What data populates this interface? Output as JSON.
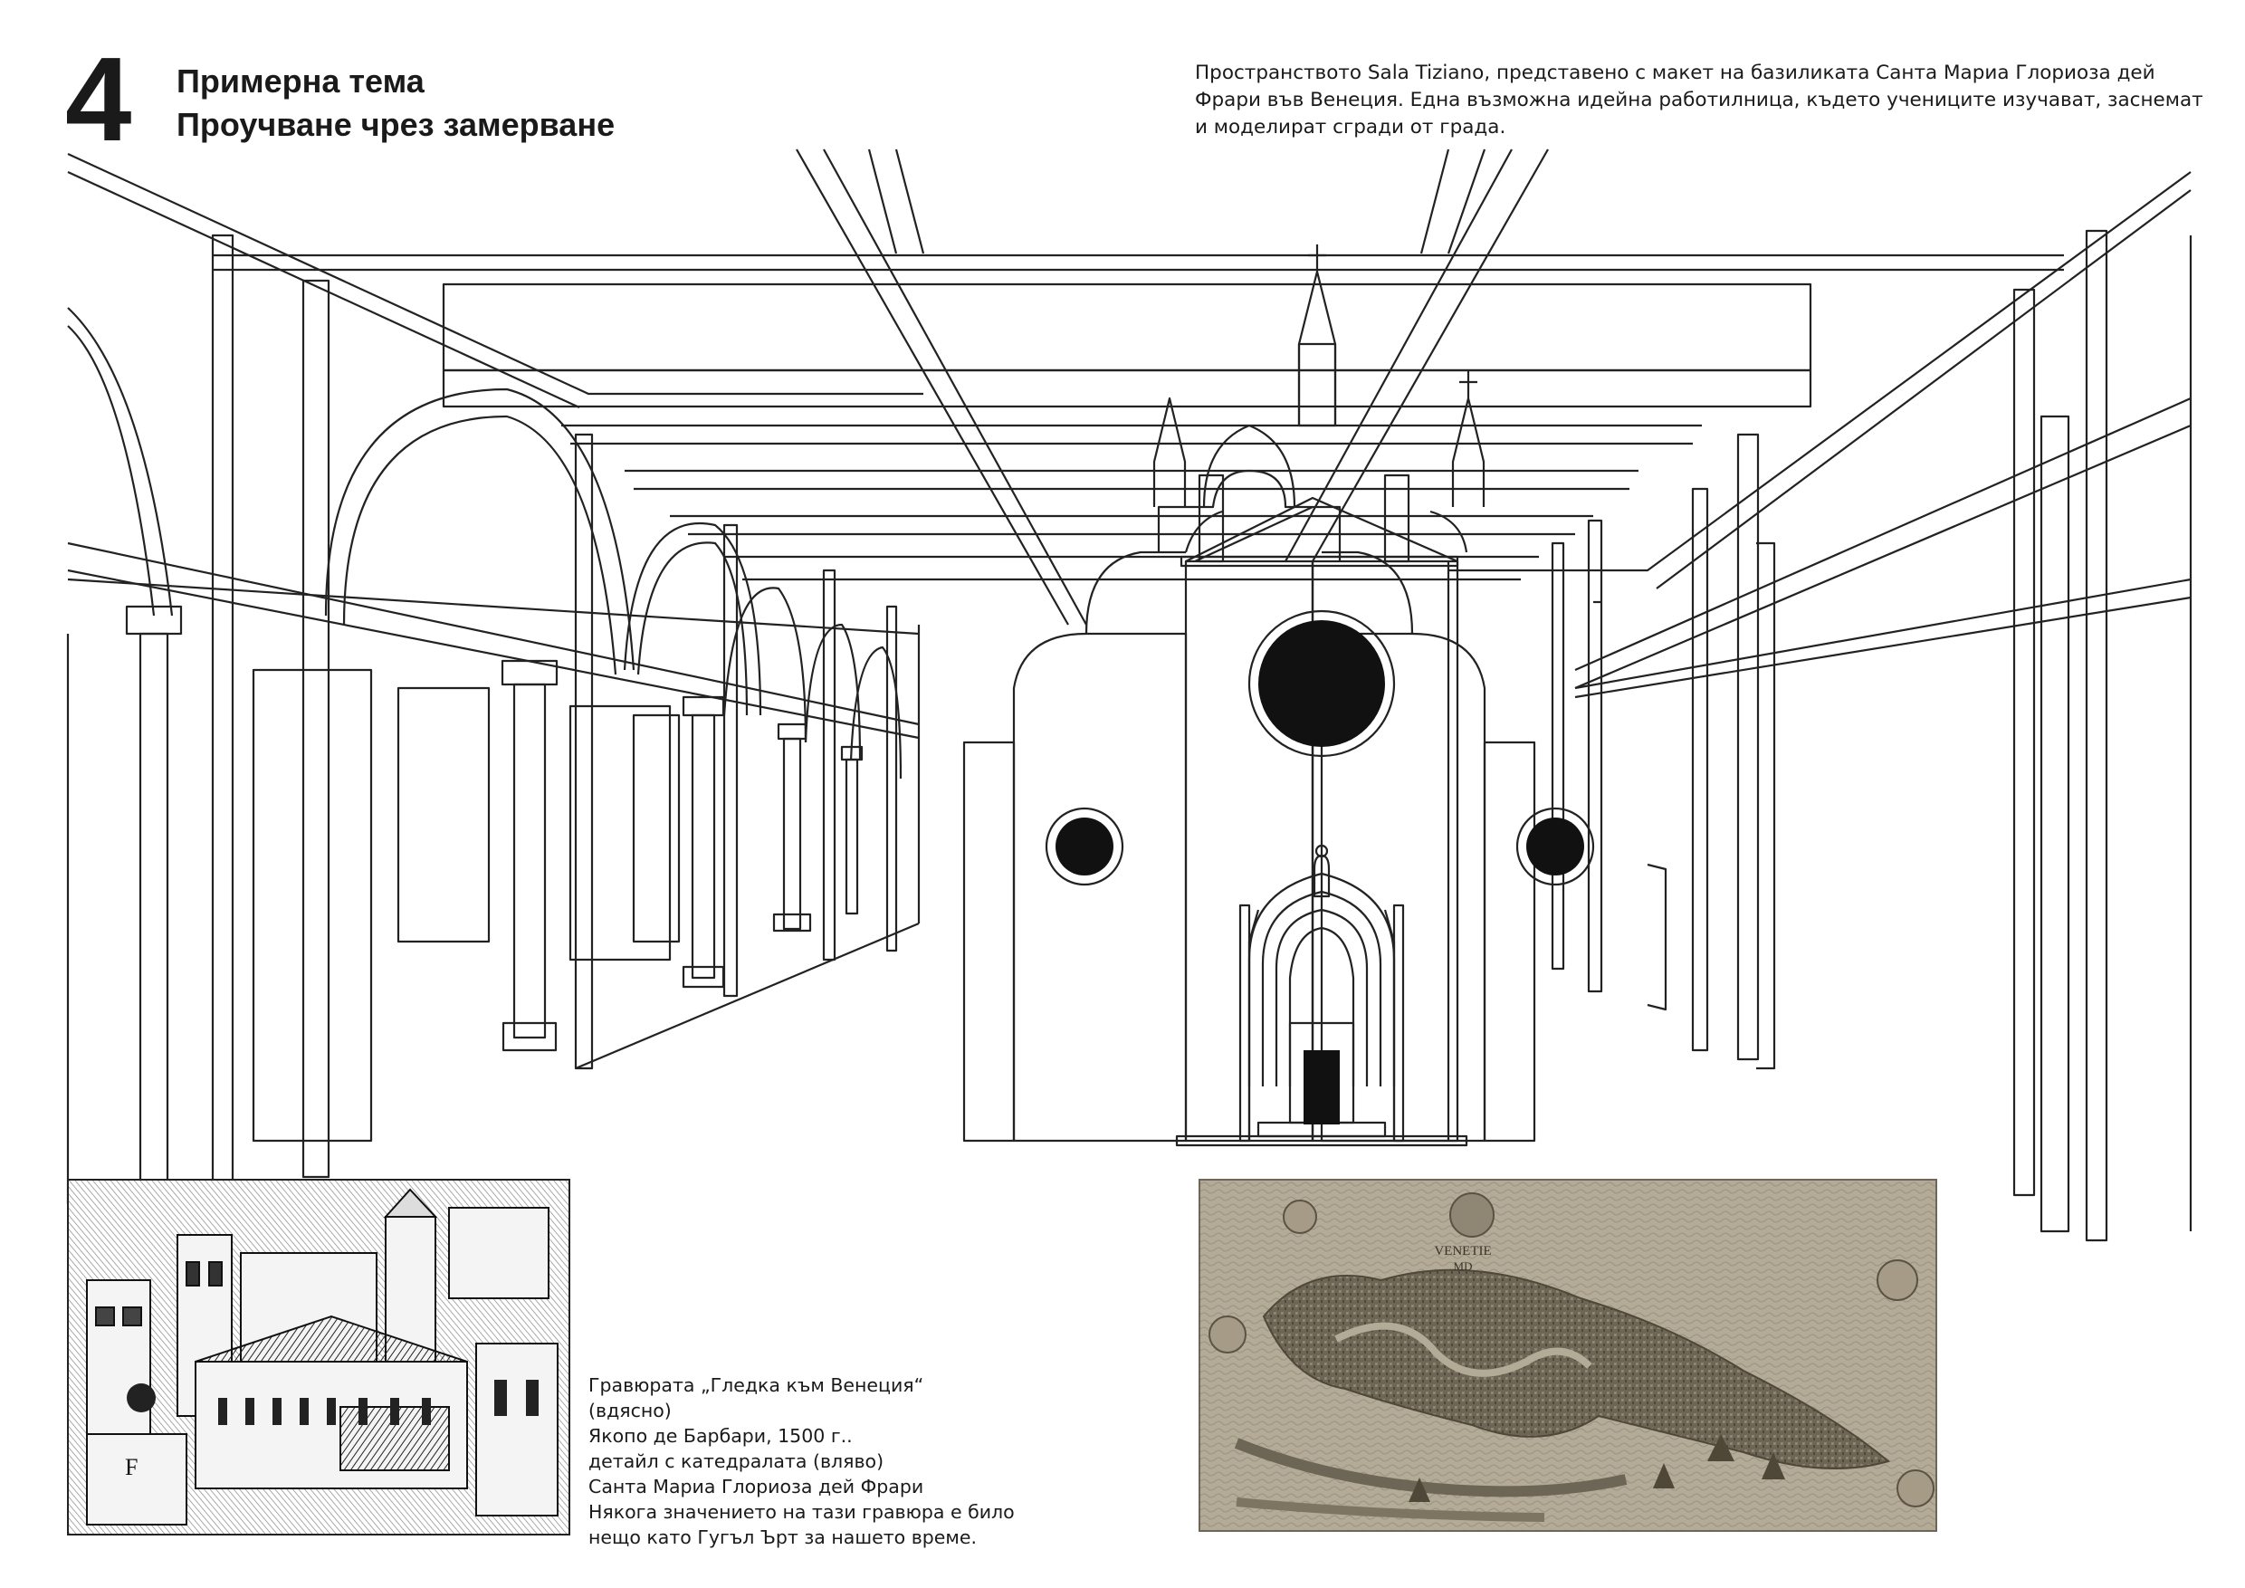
{
  "header": {
    "number": "4",
    "title_line1": "Примерна тема",
    "title_line2": "Проучване чрез замерване"
  },
  "description": "Пространството Sala Tiziano, представено с макет на базиликата Санта Мариа Глориоза дей Фрари във Венеция. Една възможна идейна работилница, където учениците изучават, заснемат и моделират сгради от града.",
  "map": {
    "label_line1": "VENETIE",
    "label_line2": "MD"
  },
  "engraving": {
    "label": "F"
  },
  "caption": {
    "lines": [
      "Гравюрата „Гледка към Венеция“",
      "(вдясно)",
      "Якопо де Барбари, 1500 г..",
      "детайл с катедралата (вляво)",
      "Санта Мариа Глориоза дей Фрари",
      "Някога значението на тази гравюра е било",
      "нещо като Гугъл Ърт за нашето време."
    ]
  },
  "colors": {
    "line": "#222222",
    "map_background": "#b3aa97",
    "map_water": "#a59b87",
    "map_land": "#6d6555"
  }
}
